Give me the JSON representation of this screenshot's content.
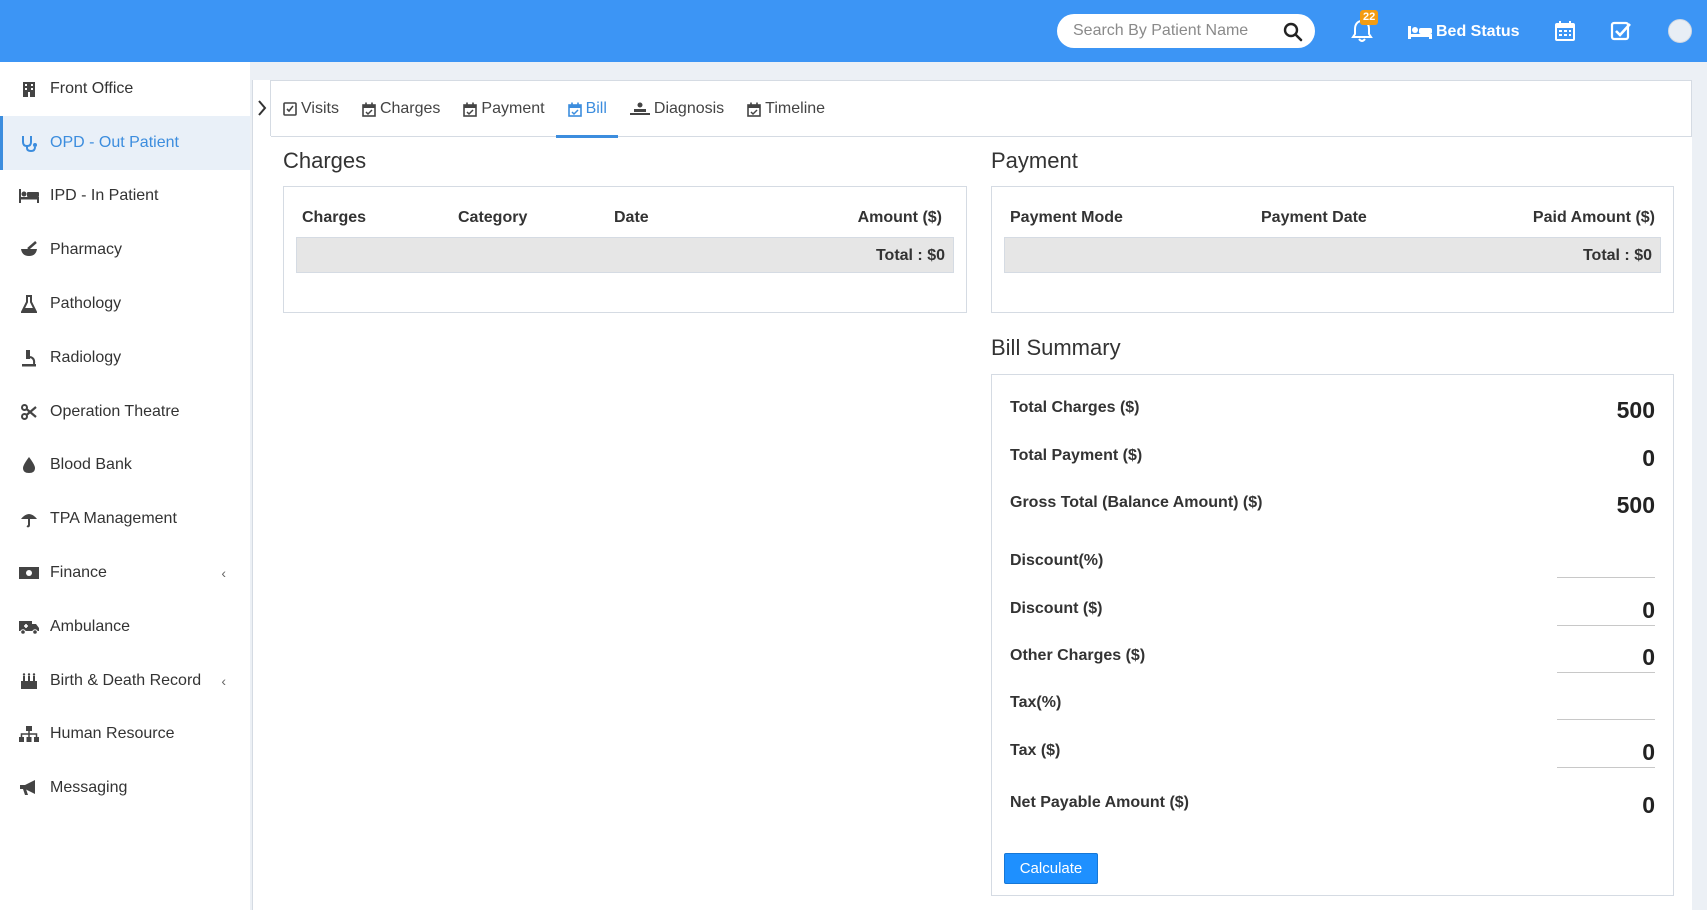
{
  "header": {
    "search_placeholder": "Search By Patient Name",
    "notification_count": "22",
    "bed_status_label": "Bed Status",
    "colors": {
      "topbar": "#3c95f5",
      "badge": "#f39c12",
      "accent": "#3c8dde"
    }
  },
  "sidebar": {
    "items": [
      {
        "label": "Front Office",
        "icon": "building-icon"
      },
      {
        "label": "OPD - Out Patient",
        "icon": "stethoscope-icon",
        "active": true
      },
      {
        "label": "IPD - In Patient",
        "icon": "bed-icon"
      },
      {
        "label": "Pharmacy",
        "icon": "mortar-pestle-icon"
      },
      {
        "label": "Pathology",
        "icon": "flask-icon"
      },
      {
        "label": "Radiology",
        "icon": "microscope-icon"
      },
      {
        "label": "Operation Theatre",
        "icon": "scissors-icon"
      },
      {
        "label": "Blood Bank",
        "icon": "drop-icon"
      },
      {
        "label": "TPA Management",
        "icon": "umbrella-icon"
      },
      {
        "label": "Finance",
        "icon": "money-icon",
        "has_submenu": true
      },
      {
        "label": "Ambulance",
        "icon": "ambulance-icon"
      },
      {
        "label": "Birth & Death Record",
        "icon": "birthday-cake-icon",
        "has_submenu": true
      },
      {
        "label": "Human Resource",
        "icon": "sitemap-icon"
      },
      {
        "label": "Messaging",
        "icon": "bullhorn-icon"
      }
    ]
  },
  "tabs": [
    {
      "label": "Visits",
      "icon": "check-square-icon"
    },
    {
      "label": "Charges",
      "icon": "calendar-check-icon"
    },
    {
      "label": "Payment",
      "icon": "calendar-check-icon"
    },
    {
      "label": "Bill",
      "icon": "calendar-check-icon",
      "active": true
    },
    {
      "label": "Diagnosis",
      "icon": "procedures-icon"
    },
    {
      "label": "Timeline",
      "icon": "calendar-check-icon"
    }
  ],
  "charges": {
    "title": "Charges",
    "columns": [
      "Charges",
      "Category",
      "Date",
      "Amount ($)"
    ],
    "total": "Total : $0"
  },
  "payment": {
    "title": "Payment",
    "columns": [
      "Payment Mode",
      "Payment Date",
      "Paid Amount ($)"
    ],
    "total": "Total : $0"
  },
  "bill_summary": {
    "title": "Bill Summary",
    "rows": [
      {
        "label": "Total Charges ($)",
        "value": "500"
      },
      {
        "label": "Total Payment ($)",
        "value": "0"
      },
      {
        "label": "Gross Total (Balance Amount) ($)",
        "value": "500"
      },
      {
        "label": "Discount(%)",
        "value": ""
      },
      {
        "label": "Discount ($)",
        "value": "0"
      },
      {
        "label": "Other Charges ($)",
        "value": "0"
      },
      {
        "label": "Tax(%)",
        "value": ""
      },
      {
        "label": "Tax ($)",
        "value": "0"
      },
      {
        "label": "Net Payable Amount ($)",
        "value": "0"
      }
    ],
    "calculate_label": "Calculate"
  }
}
